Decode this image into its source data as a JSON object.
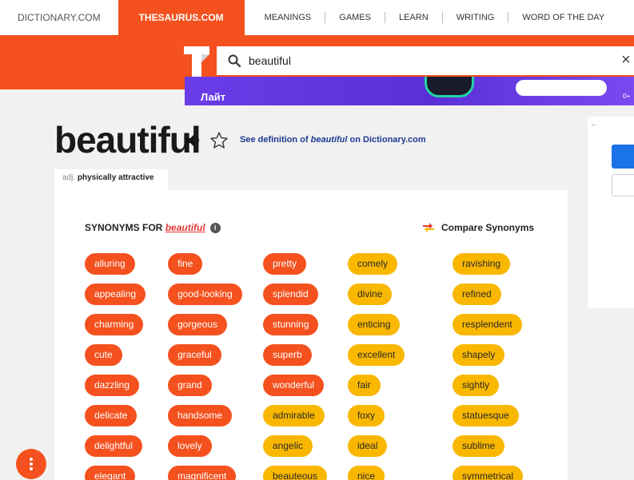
{
  "topnav": {
    "sites": [
      {
        "label": "DICTIONARY.COM",
        "active": false
      },
      {
        "label": "THESAURUS.COM",
        "active": true
      }
    ],
    "menu": [
      "MEANINGS",
      "GAMES",
      "LEARN",
      "WRITING",
      "WORD OF THE DAY"
    ]
  },
  "search": {
    "value": "beautiful",
    "clear_label": "×"
  },
  "ad": {
    "text": "Лайт",
    "age": "0+"
  },
  "entry": {
    "word": "beautiful",
    "definition_link": {
      "prefix": "See definition of ",
      "word": "beautiful",
      "suffix": " on Dictionary.com"
    },
    "sense": {
      "pos": "adj.",
      "definition": "physically attractive"
    }
  },
  "synonyms": {
    "header_prefix": "SYNONYMS FOR ",
    "header_word": "beautiful",
    "info_label": "i",
    "compare_label": "Compare Synonyms",
    "columns": [
      [
        {
          "word": "alluring",
          "rel": "hi"
        },
        {
          "word": "appealing",
          "rel": "hi"
        },
        {
          "word": "charming",
          "rel": "hi"
        },
        {
          "word": "cute",
          "rel": "hi"
        },
        {
          "word": "dazzling",
          "rel": "hi"
        },
        {
          "word": "delicate",
          "rel": "hi"
        },
        {
          "word": "delightful",
          "rel": "hi"
        },
        {
          "word": "elegant",
          "rel": "hi"
        }
      ],
      [
        {
          "word": "fine",
          "rel": "hi"
        },
        {
          "word": "good-looking",
          "rel": "hi"
        },
        {
          "word": "gorgeous",
          "rel": "hi"
        },
        {
          "word": "graceful",
          "rel": "hi"
        },
        {
          "word": "grand",
          "rel": "hi"
        },
        {
          "word": "handsome",
          "rel": "hi"
        },
        {
          "word": "lovely",
          "rel": "hi"
        },
        {
          "word": "magnificent",
          "rel": "hi"
        }
      ],
      [
        {
          "word": "pretty",
          "rel": "hi"
        },
        {
          "word": "splendid",
          "rel": "hi"
        },
        {
          "word": "stunning",
          "rel": "hi"
        },
        {
          "word": "superb",
          "rel": "hi"
        },
        {
          "word": "wonderful",
          "rel": "hi"
        },
        {
          "word": "admirable",
          "rel": "mid"
        },
        {
          "word": "angelic",
          "rel": "mid"
        },
        {
          "word": "beauteous",
          "rel": "mid"
        }
      ],
      [
        {
          "word": "comely",
          "rel": "mid"
        },
        {
          "word": "divine",
          "rel": "mid"
        },
        {
          "word": "enticing",
          "rel": "mid"
        },
        {
          "word": "excellent",
          "rel": "mid"
        },
        {
          "word": "fair",
          "rel": "mid"
        },
        {
          "word": "foxy",
          "rel": "mid"
        },
        {
          "word": "ideal",
          "rel": "mid"
        },
        {
          "word": "nice",
          "rel": "mid"
        }
      ],
      [
        {
          "word": "ravishing",
          "rel": "mid"
        },
        {
          "word": "refined",
          "rel": "mid"
        },
        {
          "word": "resplendent",
          "rel": "mid"
        },
        {
          "word": "shapely",
          "rel": "mid"
        },
        {
          "word": "sightly",
          "rel": "mid"
        },
        {
          "word": "statuesque",
          "rel": "mid"
        },
        {
          "word": "sublime",
          "rel": "mid"
        },
        {
          "word": "symmetrical",
          "rel": "mid"
        }
      ]
    ]
  },
  "right_panel": {
    "back_label": "←"
  },
  "colors": {
    "brand": "#f4511e",
    "mid": "#f9b700",
    "link": "#1f3a93"
  },
  "icons": [
    "logo-t-icon",
    "search-icon",
    "close-icon",
    "speaker-icon",
    "star-icon",
    "info-icon",
    "compare-arrows-icon",
    "more-vertical-icon"
  ]
}
